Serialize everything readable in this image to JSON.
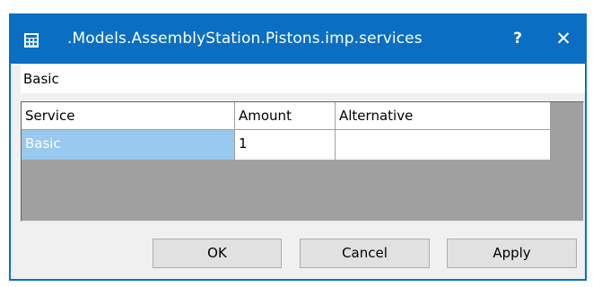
{
  "window": {
    "title": ".Models.AssemblyStation.Pistons.imp.services",
    "help_label": "?",
    "close_label": "✕",
    "icon": "table-grid-icon"
  },
  "name_field": {
    "value": "Basic"
  },
  "table": {
    "columns": [
      "Service",
      "Amount",
      "Alternative"
    ],
    "rows": [
      {
        "service": "Basic",
        "amount": "1",
        "alternative": ""
      }
    ],
    "selected_color": "#99c9ef"
  },
  "buttons": {
    "ok": "OK",
    "cancel": "Cancel",
    "apply": "Apply"
  },
  "colors": {
    "titlebar": "#0a6fc2",
    "grid_background": "#a0a0a0"
  }
}
